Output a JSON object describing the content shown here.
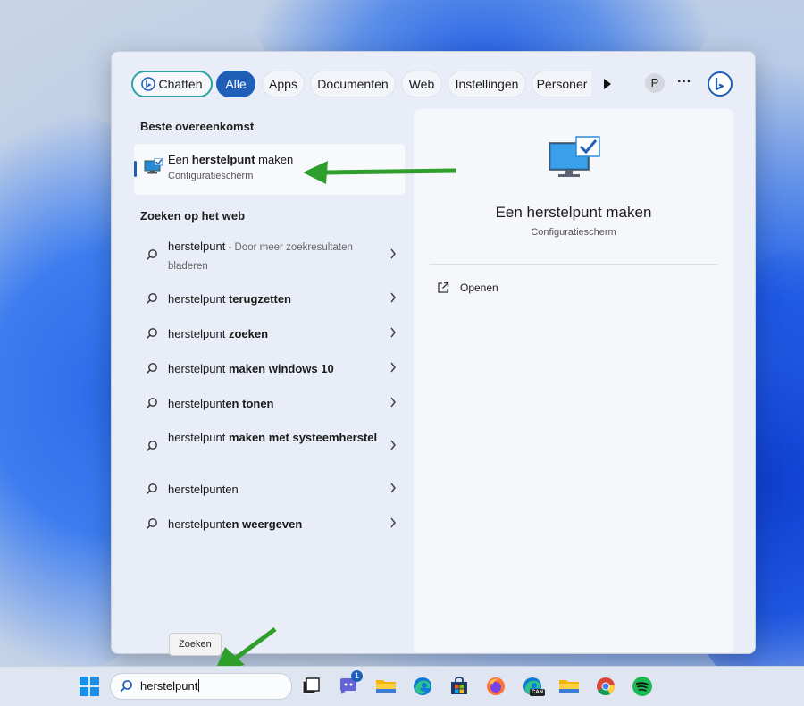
{
  "tabs": {
    "chat": "Chatten",
    "all": "Alle",
    "apps": "Apps",
    "documents": "Documenten",
    "web": "Web",
    "settings": "Instellingen",
    "people": "Personer",
    "avatar": "P",
    "more": "···"
  },
  "best_match": {
    "heading": "Beste overeenkomst",
    "title_pre": "Een ",
    "title_bold": "herstelpunt",
    "title_post": " maken",
    "subtitle": "Configuratiescherm"
  },
  "web_search": {
    "heading": "Zoeken op het web",
    "items": [
      {
        "pre": "herstelpunt",
        "bold": "",
        "muted": " - Door meer zoekresultaten bladeren"
      },
      {
        "pre": "herstelpunt ",
        "bold": "terugzetten",
        "muted": ""
      },
      {
        "pre": "herstelpunt ",
        "bold": "zoeken",
        "muted": ""
      },
      {
        "pre": "herstelpunt ",
        "bold": "maken windows 10",
        "muted": ""
      },
      {
        "pre": "herstelpunt",
        "bold": "en tonen",
        "muted": ""
      },
      {
        "pre": "herstelpunt ",
        "bold": "maken met systeemherstel",
        "muted": ""
      },
      {
        "pre": "herstelpunten",
        "bold": "",
        "muted": ""
      },
      {
        "pre": "herstelpunt",
        "bold": "en weergeven",
        "muted": ""
      }
    ]
  },
  "preview": {
    "title": "Een herstelpunt maken",
    "subtitle": "Configuratiescherm",
    "open_label": "Openen"
  },
  "tooltip": "Zoeken",
  "taskbar": {
    "search_value": "herstelpunt",
    "teams_badge": "1",
    "edge_can_label": "CAN"
  },
  "colors": {
    "accent": "#1f5fb8",
    "arrow_green": "#2e9f2a",
    "chat_border": "#2fa1a0"
  }
}
